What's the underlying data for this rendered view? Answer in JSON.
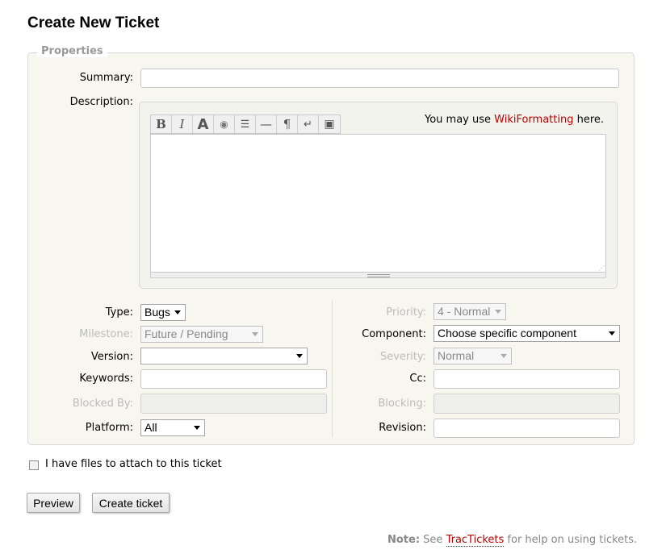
{
  "page": {
    "title": "Create New Ticket"
  },
  "properties": {
    "legend": "Properties",
    "summary_label": "Summary:",
    "description_label": "Description:",
    "wiki_hint_prefix": "You may use ",
    "wiki_hint_link": "WikiFormatting",
    "wiki_hint_suffix": " here.",
    "toolbar": [
      {
        "name": "bold-icon",
        "glyph": "B"
      },
      {
        "name": "italic-icon",
        "glyph": "I"
      },
      {
        "name": "heading-icon",
        "glyph": "A"
      },
      {
        "name": "link-icon",
        "glyph": "◉"
      },
      {
        "name": "code-block-icon",
        "glyph": "☰"
      },
      {
        "name": "horizontal-rule-icon",
        "glyph": "—"
      },
      {
        "name": "paragraph-icon",
        "glyph": "¶"
      },
      {
        "name": "line-break-icon",
        "glyph": "↵"
      },
      {
        "name": "image-icon",
        "glyph": "▣"
      }
    ],
    "left": {
      "type": {
        "label": "Type:",
        "value": "Bugs"
      },
      "milestone": {
        "label": "Milestone:",
        "value": "Future / Pending"
      },
      "version": {
        "label": "Version:",
        "value": ""
      },
      "keywords": {
        "label": "Keywords:"
      },
      "blocked_by": {
        "label": "Blocked By:"
      },
      "platform": {
        "label": "Platform:",
        "value": "All"
      }
    },
    "right": {
      "priority": {
        "label": "Priority:",
        "value": "4 - Normal"
      },
      "component": {
        "label": "Component:",
        "value": "Choose specific component"
      },
      "severity": {
        "label": "Severity:",
        "value": "Normal"
      },
      "cc": {
        "label": "Cc:"
      },
      "blocking": {
        "label": "Blocking:"
      },
      "revision": {
        "label": "Revision:"
      }
    }
  },
  "attach": {
    "label": "I have files to attach to this ticket",
    "checked": false
  },
  "buttons": {
    "preview": "Preview",
    "create": "Create ticket"
  },
  "note": {
    "prefix": "Note:",
    "see": " See ",
    "link": "TracTickets",
    "suffix": " for help on using tickets."
  }
}
